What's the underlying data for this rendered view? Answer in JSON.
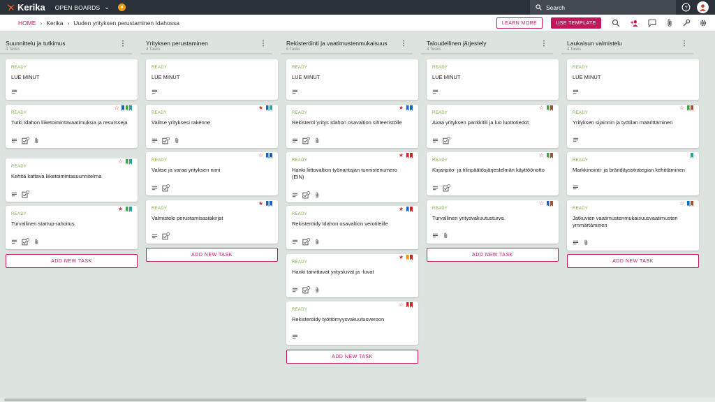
{
  "app": {
    "name": "Kerika",
    "open_boards": "OPEN BOARDS",
    "search_label": "Search"
  },
  "breadcrumb": {
    "home": "HOME",
    "org": "Kerika",
    "project": "Uuden yrityksen perustaminen Idahossa"
  },
  "actions": {
    "learn_more": "LEARN MORE",
    "use_template": "USE TEMPLATE"
  },
  "add_task_label": "ADD NEW TASK",
  "columns": [
    {
      "title": "Suunnittelu ja tutkimus",
      "count": "4 Tasks",
      "cards": [
        {
          "status": "READY",
          "title": "LUE MINUT"
        },
        {
          "status": "READY",
          "title": "Tutki Idahon liiketoimintavaatimuksia ja resursseja"
        },
        {
          "status": "READY",
          "title": "Kehitä kattava liiketoimintasuunnitelma"
        },
        {
          "status": "READY",
          "title": "Turvallinen startup-rahoitus"
        }
      ]
    },
    {
      "title": "Yrityksen perustaminen",
      "count": "4 Tasks",
      "cards": [
        {
          "status": "READY",
          "title": "LUE MINUT"
        },
        {
          "status": "READY",
          "title": "Valitse yrityksesi rakenne"
        },
        {
          "status": "READY",
          "title": "Valitse ja varaa yrityksen nimi"
        },
        {
          "status": "READY",
          "title": "Valmistele perustamisasiakirjat"
        }
      ]
    },
    {
      "title": "Rekisteröinti ja vaatimustenmukaisuus",
      "count": "6 Tasks",
      "cards": [
        {
          "status": "READY",
          "title": "LUE MINUT"
        },
        {
          "status": "READY",
          "title": "Rekisteröi yritys Idahon osavaltion sihteeristölle"
        },
        {
          "status": "READY",
          "title": "Hanki liittovaltion työnantajan tunnistenumero (EIN)"
        },
        {
          "status": "READY",
          "title": "Rekisteröidy Idahon osavaltion verotileille"
        },
        {
          "status": "READY",
          "title": "Hanki tarvittavat yritysluvat ja -luvat"
        },
        {
          "status": "READY",
          "title": "Rekisteröidy työttömyysvakuutusveroon"
        }
      ]
    },
    {
      "title": "Taloudellinen järjestely",
      "count": "4 Tasks",
      "cards": [
        {
          "status": "READY",
          "title": "LUE MINUT"
        },
        {
          "status": "READY",
          "title": "Avaa yrityksen pankkitili ja luo luottotiedot"
        },
        {
          "status": "READY",
          "title": "Kirjanpito- ja tilinpäätösjärjestelmän käyttöönotto"
        },
        {
          "status": "READY",
          "title": "Turvallinen yritysvakuutusturva"
        }
      ]
    },
    {
      "title": "Laukaisun valmistelu",
      "count": "4 Tasks",
      "cards": [
        {
          "status": "READY",
          "title": "LUE MINUT"
        },
        {
          "status": "READY",
          "title": "Yrityksen sijainnin ja työtilan määrittäminen"
        },
        {
          "status": "READY",
          "title": "Markkinointi- ja brändäysstrategian kehittäminen"
        },
        {
          "status": "READY",
          "title": "Jatkuvien vaatimustenmukaisuusvaatimusten ymmärtäminen"
        }
      ]
    }
  ],
  "colors": {
    "brand": "#c2185b",
    "ready": "#7cb342",
    "topbar": "#2b3138"
  }
}
